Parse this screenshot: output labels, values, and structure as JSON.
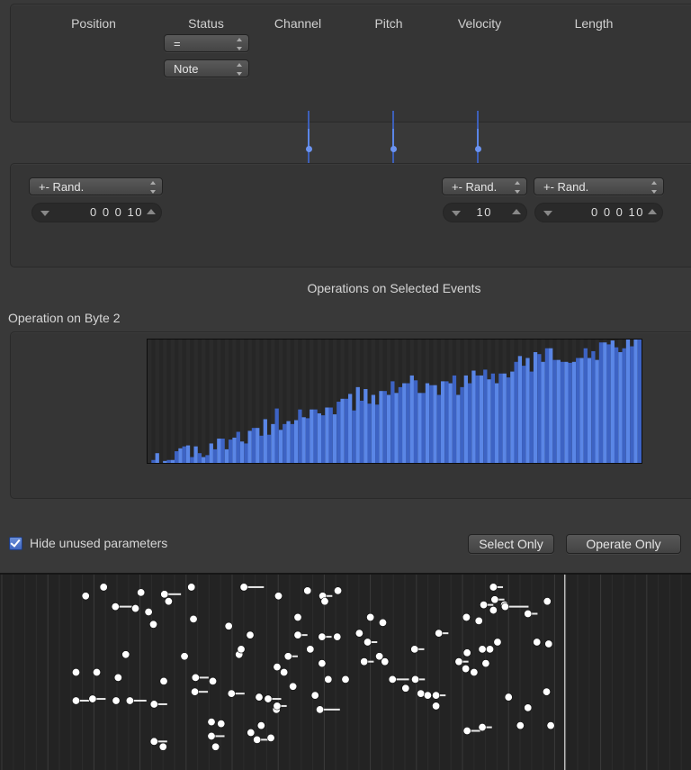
{
  "columns": {
    "position": "Position",
    "status": "Status",
    "channel": "Channel",
    "pitch": "Pitch",
    "velocity": "Velocity",
    "length": "Length"
  },
  "status_condition": {
    "value": "="
  },
  "status_type": {
    "value": "Note"
  },
  "operations": {
    "position": {
      "mode": "+- Rand.",
      "value": "0 0 0   10"
    },
    "velocity": {
      "mode": "+- Rand.",
      "value": "10"
    },
    "length": {
      "mode": "+- Rand.",
      "value": "0 0 0   10"
    }
  },
  "sliders": [
    {
      "column": "channel",
      "level": 0.65
    },
    {
      "column": "pitch",
      "level": 0.65
    },
    {
      "column": "velocity",
      "level": 0.65
    }
  ],
  "section_title": "Operations on Selected Events",
  "byte_label": "Operation on Byte 2",
  "hide_unused": {
    "label": "Hide unused parameters",
    "checked": true
  },
  "buttons": {
    "select_only": "Select Only",
    "operate_only": "Operate Only"
  },
  "colors": {
    "accent": "#5b86e8",
    "bar": "#5a86e6",
    "bar_alt": "#3d63c4",
    "note": "#ffffff"
  },
  "chart_data": {
    "type": "bar",
    "title": "Operation on Byte 2",
    "xlabel": "",
    "ylabel": "",
    "xlim": [
      0,
      127
    ],
    "ylim": [
      0,
      127
    ],
    "categories_range": [
      0,
      127
    ],
    "values": [
      0,
      3,
      10,
      0,
      2,
      3,
      3,
      12,
      15,
      17,
      18,
      6,
      17,
      10,
      6,
      8,
      20,
      14,
      25,
      25,
      14,
      24,
      26,
      32,
      22,
      20,
      33,
      36,
      36,
      28,
      45,
      29,
      40,
      56,
      34,
      40,
      43,
      40,
      44,
      55,
      47,
      46,
      55,
      55,
      51,
      49,
      57,
      57,
      50,
      63,
      66,
      66,
      71,
      54,
      78,
      64,
      76,
      61,
      70,
      60,
      74,
      74,
      70,
      84,
      72,
      78,
      82,
      82,
      90,
      85,
      72,
      72,
      82,
      80,
      80,
      70,
      84,
      84,
      82,
      90,
      70,
      78,
      90,
      82,
      95,
      90,
      90,
      96,
      86,
      92,
      82,
      92,
      92,
      88,
      94,
      104,
      110,
      100,
      108,
      94,
      114,
      112,
      104,
      118,
      118,
      106,
      106,
      104,
      104,
      103,
      104,
      108,
      108,
      118,
      108,
      115,
      106,
      124,
      124,
      122,
      126,
      119,
      114,
      118,
      130,
      120,
      127,
      127
    ],
    "grid": false
  },
  "piano_roll": {
    "notes": [
      {
        "pos": 0.124,
        "pitch": 0.93,
        "len": 0
      },
      {
        "pos": 0.15,
        "pitch": 0.98,
        "len": 0
      },
      {
        "pos": 0.167,
        "pitch": 0.87,
        "len": 0.02
      },
      {
        "pos": 0.196,
        "pitch": 0.86,
        "len": 0
      },
      {
        "pos": 0.204,
        "pitch": 0.95,
        "len": 0
      },
      {
        "pos": 0.238,
        "pitch": 0.94,
        "len": 0.02
      },
      {
        "pos": 0.244,
        "pitch": 0.9,
        "len": 0
      },
      {
        "pos": 0.277,
        "pitch": 0.98,
        "len": 0
      },
      {
        "pos": 0.28,
        "pitch": 0.8,
        "len": 0
      },
      {
        "pos": 0.353,
        "pitch": 0.98,
        "len": 0.025
      },
      {
        "pos": 0.403,
        "pitch": 0.93,
        "len": 0
      },
      {
        "pos": 0.331,
        "pitch": 0.76,
        "len": 0
      },
      {
        "pos": 0.222,
        "pitch": 0.77,
        "len": 0
      },
      {
        "pos": 0.215,
        "pitch": 0.84,
        "len": 0
      },
      {
        "pos": 0.182,
        "pitch": 0.6,
        "len": 0
      },
      {
        "pos": 0.267,
        "pitch": 0.59,
        "len": 0
      },
      {
        "pos": 0.362,
        "pitch": 0.71,
        "len": 0
      },
      {
        "pos": 0.346,
        "pitch": 0.6,
        "len": 0
      },
      {
        "pos": 0.11,
        "pitch": 0.5,
        "len": 0
      },
      {
        "pos": 0.14,
        "pitch": 0.5,
        "len": 0
      },
      {
        "pos": 0.171,
        "pitch": 0.47,
        "len": 0
      },
      {
        "pos": 0.237,
        "pitch": 0.45,
        "len": 0
      },
      {
        "pos": 0.283,
        "pitch": 0.47,
        "len": 0.015
      },
      {
        "pos": 0.349,
        "pitch": 0.63,
        "len": 0
      },
      {
        "pos": 0.11,
        "pitch": 0.34,
        "len": 0.015
      },
      {
        "pos": 0.134,
        "pitch": 0.35,
        "len": 0.015
      },
      {
        "pos": 0.168,
        "pitch": 0.34,
        "len": 0
      },
      {
        "pos": 0.188,
        "pitch": 0.34,
        "len": 0.02
      },
      {
        "pos": 0.223,
        "pitch": 0.32,
        "len": 0.015
      },
      {
        "pos": 0.282,
        "pitch": 0.39,
        "len": 0.015
      },
      {
        "pos": 0.335,
        "pitch": 0.38,
        "len": 0.015
      },
      {
        "pos": 0.375,
        "pitch": 0.36,
        "len": 0
      },
      {
        "pos": 0.388,
        "pitch": 0.35,
        "len": 0.015
      },
      {
        "pos": 0.308,
        "pitch": 0.45,
        "len": 0
      },
      {
        "pos": 0.223,
        "pitch": 0.11,
        "len": 0.015
      },
      {
        "pos": 0.236,
        "pitch": 0.08,
        "len": 0
      },
      {
        "pos": 0.306,
        "pitch": 0.22,
        "len": 0
      },
      {
        "pos": 0.32,
        "pitch": 0.21,
        "len": 0
      },
      {
        "pos": 0.306,
        "pitch": 0.14,
        "len": 0.015
      },
      {
        "pos": 0.378,
        "pitch": 0.2,
        "len": 0
      },
      {
        "pos": 0.4,
        "pitch": 0.29,
        "len": 0
      },
      {
        "pos": 0.312,
        "pitch": 0.08,
        "len": 0
      },
      {
        "pos": 0.363,
        "pitch": 0.16,
        "len": 0
      },
      {
        "pos": 0.372,
        "pitch": 0.12,
        "len": 0.02
      },
      {
        "pos": 0.392,
        "pitch": 0.13,
        "len": 0
      },
      {
        "pos": 0.445,
        "pitch": 0.96,
        "len": 0
      },
      {
        "pos": 0.467,
        "pitch": 0.93,
        "len": 0.01
      },
      {
        "pos": 0.47,
        "pitch": 0.9,
        "len": 0
      },
      {
        "pos": 0.489,
        "pitch": 0.96,
        "len": 0
      },
      {
        "pos": 0.536,
        "pitch": 0.81,
        "len": 0
      },
      {
        "pos": 0.431,
        "pitch": 0.81,
        "len": 0
      },
      {
        "pos": 0.431,
        "pitch": 0.71,
        "len": 0.01
      },
      {
        "pos": 0.466,
        "pitch": 0.7,
        "len": 0.01
      },
      {
        "pos": 0.488,
        "pitch": 0.7,
        "len": 0
      },
      {
        "pos": 0.554,
        "pitch": 0.78,
        "len": 0
      },
      {
        "pos": 0.52,
        "pitch": 0.72,
        "len": 0
      },
      {
        "pos": 0.449,
        "pitch": 0.63,
        "len": 0
      },
      {
        "pos": 0.417,
        "pitch": 0.59,
        "len": 0.01
      },
      {
        "pos": 0.411,
        "pitch": 0.5,
        "len": 0
      },
      {
        "pos": 0.401,
        "pitch": 0.53,
        "len": 0
      },
      {
        "pos": 0.466,
        "pitch": 0.55,
        "len": 0
      },
      {
        "pos": 0.475,
        "pitch": 0.46,
        "len": 0
      },
      {
        "pos": 0.424,
        "pitch": 0.42,
        "len": 0
      },
      {
        "pos": 0.456,
        "pitch": 0.37,
        "len": 0
      },
      {
        "pos": 0.401,
        "pitch": 0.31,
        "len": 0.01
      },
      {
        "pos": 0.463,
        "pitch": 0.29,
        "len": 0.025
      },
      {
        "pos": 0.5,
        "pitch": 0.46,
        "len": 0
      },
      {
        "pos": 0.549,
        "pitch": 0.59,
        "len": 0
      },
      {
        "pos": 0.532,
        "pitch": 0.67,
        "len": 0.01
      },
      {
        "pos": 0.527,
        "pitch": 0.56,
        "len": 0.01
      },
      {
        "pos": 0.557,
        "pitch": 0.56,
        "len": 0
      },
      {
        "pos": 0.568,
        "pitch": 0.46,
        "len": 0.02
      },
      {
        "pos": 0.601,
        "pitch": 0.46,
        "len": 0.01
      },
      {
        "pos": 0.587,
        "pitch": 0.41,
        "len": 0
      },
      {
        "pos": 0.609,
        "pitch": 0.38,
        "len": 0
      },
      {
        "pos": 0.619,
        "pitch": 0.37,
        "len": 0
      },
      {
        "pos": 0.631,
        "pitch": 0.37,
        "len": 0.01
      },
      {
        "pos": 0.631,
        "pitch": 0.31,
        "len": 0
      },
      {
        "pos": 0.6,
        "pitch": 0.63,
        "len": 0.01
      },
      {
        "pos": 0.635,
        "pitch": 0.72,
        "len": 0.01
      },
      {
        "pos": 0.675,
        "pitch": 0.81,
        "len": 0
      },
      {
        "pos": 0.693,
        "pitch": 0.79,
        "len": 0
      },
      {
        "pos": 0.664,
        "pitch": 0.56,
        "len": 0.01
      },
      {
        "pos": 0.674,
        "pitch": 0.52,
        "len": 0
      },
      {
        "pos": 0.686,
        "pitch": 0.5,
        "len": 0
      },
      {
        "pos": 0.714,
        "pitch": 0.98,
        "len": 0.01
      },
      {
        "pos": 0.7,
        "pitch": 0.88,
        "len": 0.01
      },
      {
        "pos": 0.714,
        "pitch": 0.85,
        "len": 0
      },
      {
        "pos": 0.73,
        "pitch": 0.88,
        "len": 0
      },
      {
        "pos": 0.676,
        "pitch": 0.61,
        "len": 0
      },
      {
        "pos": 0.698,
        "pitch": 0.63,
        "len": 0
      },
      {
        "pos": 0.703,
        "pitch": 0.55,
        "len": 0
      },
      {
        "pos": 0.709,
        "pitch": 0.63,
        "len": 0
      },
      {
        "pos": 0.72,
        "pitch": 0.67,
        "len": 0
      },
      {
        "pos": 0.676,
        "pitch": 0.17,
        "len": 0.015
      },
      {
        "pos": 0.698,
        "pitch": 0.19,
        "len": 0.01
      },
      {
        "pos": 0.716,
        "pitch": 0.91,
        "len": 0.01
      },
      {
        "pos": 0.731,
        "pitch": 0.87,
        "len": 0.03
      },
      {
        "pos": 0.764,
        "pitch": 0.83,
        "len": 0.01
      },
      {
        "pos": 0.792,
        "pitch": 0.9,
        "len": 0
      },
      {
        "pos": 0.777,
        "pitch": 0.67,
        "len": 0
      },
      {
        "pos": 0.794,
        "pitch": 0.66,
        "len": 0
      },
      {
        "pos": 0.736,
        "pitch": 0.36,
        "len": 0
      },
      {
        "pos": 0.791,
        "pitch": 0.39,
        "len": 0
      },
      {
        "pos": 0.764,
        "pitch": 0.3,
        "len": 0
      },
      {
        "pos": 0.753,
        "pitch": 0.2,
        "len": 0
      },
      {
        "pos": 0.797,
        "pitch": 0.2,
        "len": 0
      }
    ],
    "playhead": 0.818
  }
}
